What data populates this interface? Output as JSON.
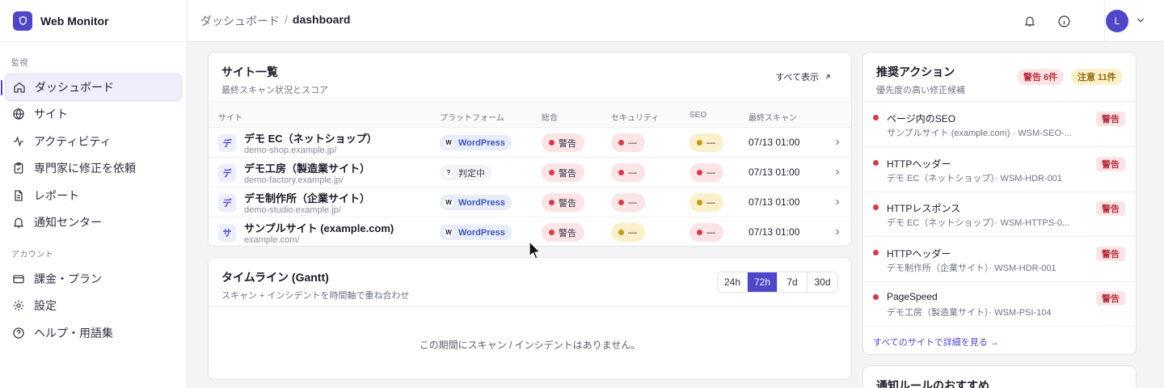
{
  "brand": {
    "name": "Web Monitor"
  },
  "sidebar": {
    "section_monitor": "監視",
    "section_account": "アカウント",
    "monitor_items": [
      {
        "label": "ダッシュボード",
        "icon": "home-icon"
      },
      {
        "label": "サイト",
        "icon": "globe-icon"
      },
      {
        "label": "アクティビティ",
        "icon": "activity-icon"
      },
      {
        "label": "専門家に修正を依頼",
        "icon": "clipboard-icon"
      },
      {
        "label": "レポート",
        "icon": "document-icon"
      },
      {
        "label": "通知センター",
        "icon": "bell-icon"
      }
    ],
    "account_items": [
      {
        "label": "課金・プラン",
        "icon": "credit-card-icon"
      },
      {
        "label": "設定",
        "icon": "gear-icon"
      },
      {
        "label": "ヘルプ・用語集",
        "icon": "help-icon"
      }
    ]
  },
  "topbar": {
    "breadcrumb_parent": "ダッシュボード",
    "breadcrumb_sep": "/",
    "breadcrumb_current": "dashboard",
    "avatar_initial": "L"
  },
  "sites": {
    "title": "サイト一覧",
    "subtitle": "最終スキャン状況とスコア",
    "show_all": "すべて表示",
    "columns": [
      "サイト",
      "プラットフォーム",
      "総合",
      "セキュリティ",
      "SEO",
      "最終スキャン"
    ],
    "rows": [
      {
        "initial": "デ",
        "name": "デモ EC（ネットショップ）",
        "url": "demo-shop.example.jp/",
        "platform": "WordPress",
        "platform_glyph": "W",
        "platform_kind": "wp",
        "overall": "警告",
        "overall_color": "red",
        "security": "—",
        "security_color": "red",
        "seo": "—",
        "seo_color": "yel",
        "scan": "07/13 01:00"
      },
      {
        "initial": "デ",
        "name": "デモ工房（製造業サイト）",
        "url": "demo-factory.example.jp/",
        "platform": "判定中",
        "platform_glyph": "?",
        "platform_kind": "unk",
        "overall": "警告",
        "overall_color": "red",
        "security": "—",
        "security_color": "red",
        "seo": "—",
        "seo_color": "red",
        "scan": "07/13 01:00"
      },
      {
        "initial": "デ",
        "name": "デモ制作所（企業サイト）",
        "url": "demo-studio.example.jp/",
        "platform": "WordPress",
        "platform_glyph": "W",
        "platform_kind": "wp",
        "overall": "警告",
        "overall_color": "red",
        "security": "—",
        "security_color": "red",
        "seo": "—",
        "seo_color": "yel",
        "scan": "07/13 01:00"
      },
      {
        "initial": "サ",
        "name": "サンプルサイト (example.com)",
        "url": "example.com/",
        "platform": "WordPress",
        "platform_glyph": "W",
        "platform_kind": "wp",
        "overall": "警告",
        "overall_color": "red",
        "security": "—",
        "security_color": "yel",
        "seo": "—",
        "seo_color": "red",
        "scan": "07/13 01:00"
      }
    ]
  },
  "timeline": {
    "title": "タイムライン (Gantt)",
    "subtitle": "スキャン + インシデントを時間軸で重ね合わせ",
    "ranges": [
      "24h",
      "72h",
      "7d",
      "30d"
    ],
    "selected": "72h",
    "empty": "この期間にスキャン / インシデントはありません。"
  },
  "reco": {
    "title": "推奨アクション",
    "subtitle": "優先度の高い修正候補",
    "badge_warn": "警告 6件",
    "badge_caution": "注意 11件",
    "items": [
      {
        "title": "ページ内のSEO",
        "sub": "サンプルサイト (example.com) · WSM-SEO-...",
        "badge": "警告"
      },
      {
        "title": "HTTPヘッダー",
        "sub": "デモ EC（ネットショップ）· WSM-HDR-001",
        "badge": "警告"
      },
      {
        "title": "HTTPレスポンス",
        "sub": "デモ EC（ネットショップ）· WSM-HTTPS-0...",
        "badge": "警告"
      },
      {
        "title": "HTTPヘッダー",
        "sub": "デモ制作所（企業サイト）· WSM-HDR-001",
        "badge": "警告"
      },
      {
        "title": "PageSpeed",
        "sub": "デモ工房（製造業サイト）· WSM-PSI-104",
        "badge": "警告"
      }
    ],
    "see_all": "すべてのサイトで詳細を見る →"
  },
  "rules": {
    "title": "通知ルールのおすすめ"
  },
  "colors": {
    "accent": "#4f46c8",
    "danger": "#d43c4c",
    "caution": "#c79a1a"
  }
}
